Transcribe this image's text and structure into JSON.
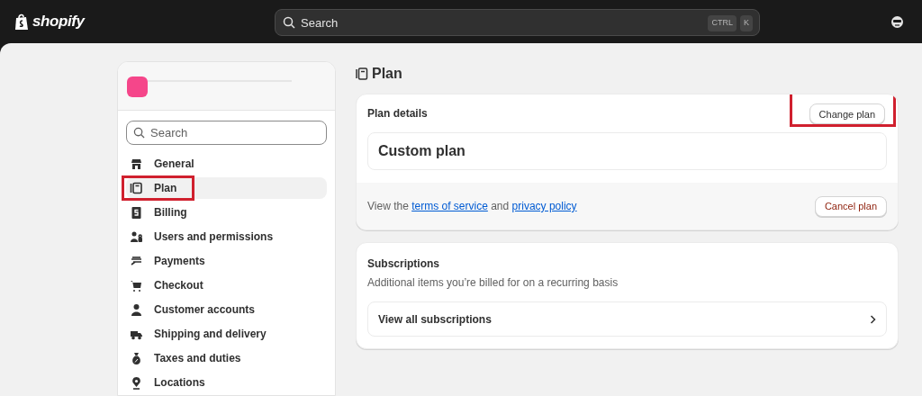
{
  "topbar": {
    "logo": "shopify",
    "search": {
      "placeholder": "Search",
      "shortcut": [
        "CTRL",
        "K"
      ]
    }
  },
  "sidebar": {
    "search": {
      "placeholder": "Search"
    },
    "items": [
      {
        "label": "General",
        "selected": false,
        "highlighted": false
      },
      {
        "label": "Plan",
        "selected": true,
        "highlighted": true
      },
      {
        "label": "Billing",
        "selected": false,
        "highlighted": false
      },
      {
        "label": "Users and permissions",
        "selected": false,
        "highlighted": false
      },
      {
        "label": "Payments",
        "selected": false,
        "highlighted": false
      },
      {
        "label": "Checkout",
        "selected": false,
        "highlighted": false
      },
      {
        "label": "Customer accounts",
        "selected": false,
        "highlighted": false
      },
      {
        "label": "Shipping and delivery",
        "selected": false,
        "highlighted": false
      },
      {
        "label": "Taxes and duties",
        "selected": false,
        "highlighted": false
      },
      {
        "label": "Locations",
        "selected": false,
        "highlighted": false
      }
    ]
  },
  "page": {
    "title": "Plan",
    "plan_card": {
      "heading": "Plan details",
      "change_button": {
        "label": "Change plan",
        "highlighted": true
      },
      "plan_name": "Custom plan",
      "footer": {
        "parts": [
          {
            "kind": "text",
            "text": "View the "
          },
          {
            "kind": "link",
            "text": "terms of service"
          },
          {
            "kind": "text",
            "text": " and "
          },
          {
            "kind": "link",
            "text": "privacy policy"
          }
        ],
        "cancel_button": "Cancel plan"
      }
    },
    "subscriptions_card": {
      "heading": "Subscriptions",
      "description": "Additional items you’re billed for on a recurring basis",
      "link_row": "View all subscriptions"
    }
  }
}
